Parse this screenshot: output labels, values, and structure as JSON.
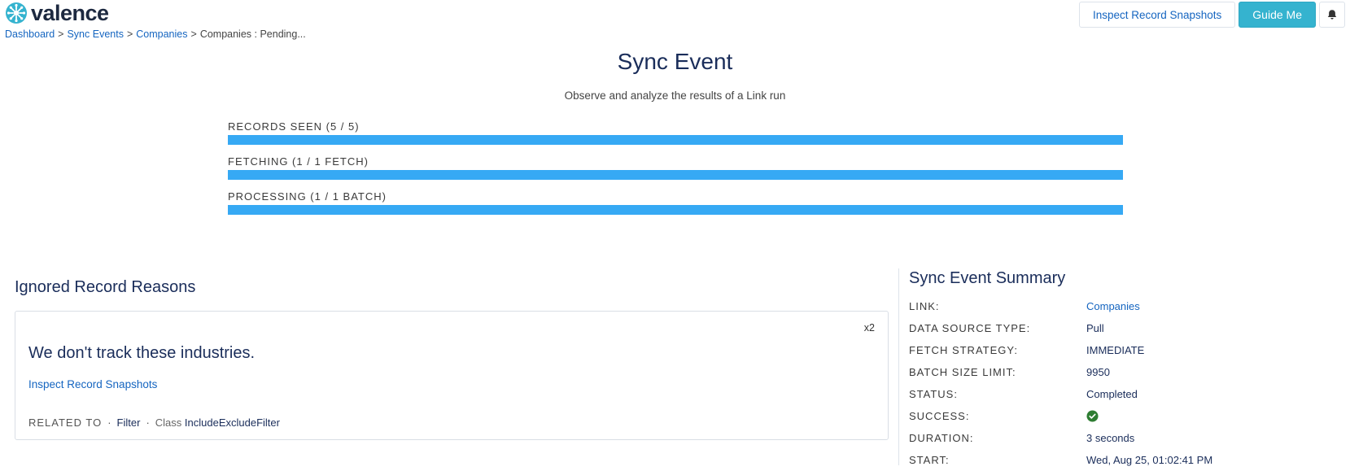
{
  "header": {
    "logo_text": "valence",
    "breadcrumb": [
      {
        "label": "Dashboard"
      },
      {
        "label": "Sync Events"
      },
      {
        "label": "Companies"
      }
    ],
    "breadcrumb_current": "Companies : Pending...",
    "breadcrumb_separator": ">",
    "inspect_button": "Inspect Record Snapshots",
    "guide_button": "Guide Me",
    "bell_icon": "bell-icon"
  },
  "page": {
    "title": "Sync Event",
    "subtitle": "Observe and analyze the results of a Link run"
  },
  "progress": [
    {
      "label": "RECORDS SEEN (5 / 5)",
      "fraction": 1.0
    },
    {
      "label": "FETCHING (1 / 1 FETCH)",
      "fraction": 1.0
    },
    {
      "label": "PROCESSING (1 / 1 BATCH)",
      "fraction": 1.0
    }
  ],
  "ignored": {
    "title": "Ignored Record Reasons",
    "reason": {
      "count": "x2",
      "text": "We don't track these industries.",
      "link": "Inspect Record Snapshots",
      "related_label": "RELATED TO",
      "related_filter": "Filter",
      "related_class_label": "Class",
      "related_class_value": "IncludeExcludeFilter"
    }
  },
  "summary": {
    "title": "Sync Event Summary",
    "rows": [
      {
        "key": "LINK:",
        "value": "Companies"
      },
      {
        "key": "DATA SOURCE TYPE:",
        "value": "Pull"
      },
      {
        "key": "FETCH STRATEGY:",
        "value": "IMMEDIATE"
      },
      {
        "key": "BATCH SIZE LIMIT:",
        "value": "9950"
      },
      {
        "key": "STATUS:",
        "value": "Completed"
      },
      {
        "key": "SUCCESS:",
        "value": "check-circle-icon"
      },
      {
        "key": "DURATION:",
        "value": "3 seconds"
      },
      {
        "key": "START:",
        "value": "Wed, Aug 25, 01:02:41 PM"
      }
    ]
  },
  "colors": {
    "accent": "#36a9f4",
    "primary_button": "#35b3cf",
    "link": "#1565c0",
    "heading": "#1a2d5a",
    "success": "#2e7d32"
  }
}
